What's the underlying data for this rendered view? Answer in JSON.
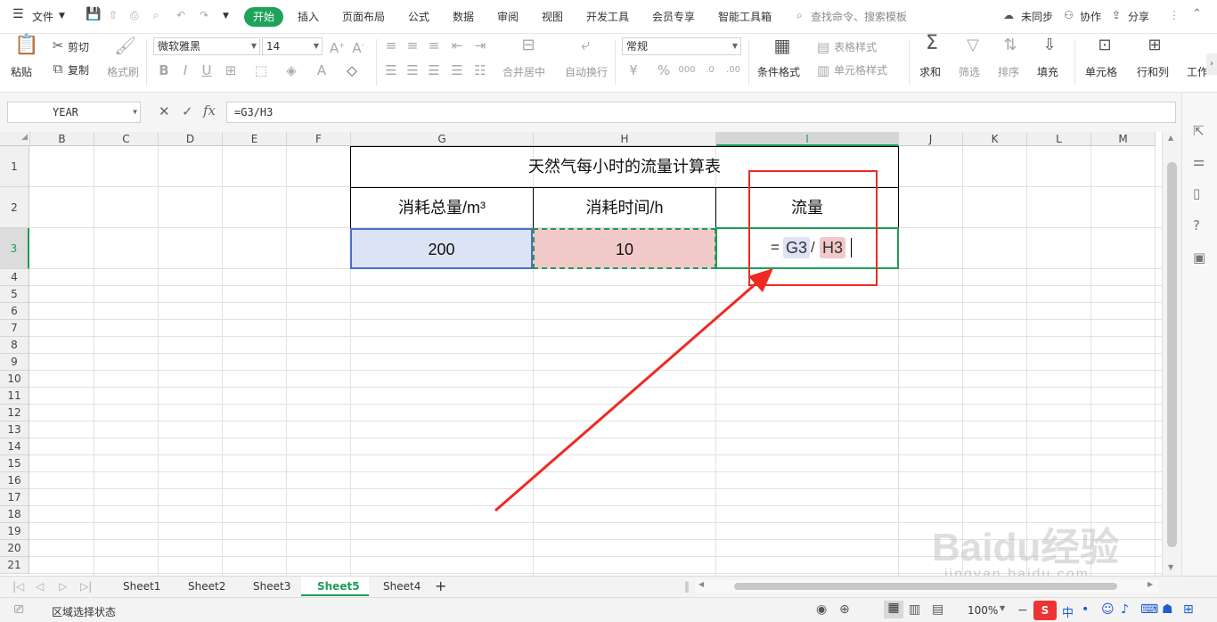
{
  "menubar": {
    "menu_icon": "hamburger-icon",
    "file": "文件",
    "tabs": [
      "开始",
      "插入",
      "页面布局",
      "公式",
      "数据",
      "审阅",
      "视图",
      "开发工具",
      "会员专享",
      "智能工具箱"
    ],
    "active_tab": "开始",
    "search_placeholder": "查找命令、搜索模板",
    "sync": "未同步",
    "collab": "协作",
    "share": "分享"
  },
  "ribbon": {
    "paste": "粘贴",
    "cut": "剪切",
    "copy": "复制",
    "format_painter": "格式刷",
    "font_name": "微软雅黑",
    "font_size": "14",
    "merge_center": "合并居中",
    "wrap_text": "自动换行",
    "number_format": "常规",
    "cond_format": "条件格式",
    "table_style": "表格样式",
    "cell_style": "单元格样式",
    "sum": "求和",
    "filter": "筛选",
    "sort": "排序",
    "fill": "填充",
    "cell": "单元格",
    "row_col": "行和列",
    "worksheet": "工作",
    "accent_color": "#1fa35b"
  },
  "formula_bar": {
    "name_box": "YEAR",
    "fx": "fx",
    "content": "=G3/H3"
  },
  "grid": {
    "columns": [
      "B",
      "C",
      "D",
      "E",
      "F",
      "G",
      "H",
      "I",
      "J",
      "K",
      "L",
      "M"
    ],
    "selected_column": "I",
    "rows": [
      "1",
      "2",
      "3",
      "4",
      "5",
      "6",
      "7",
      "8",
      "9",
      "10",
      "11",
      "12",
      "13",
      "14",
      "15",
      "16",
      "17",
      "18",
      "19",
      "20",
      "21"
    ],
    "selected_row": "3",
    "table_title": "天然气每小时的流量计算表",
    "headers": [
      "消耗总量/m³",
      "消耗时间/h",
      "流量"
    ],
    "values": [
      "200",
      "10"
    ],
    "formula_display": {
      "eq": "=",
      "ref1": "G3",
      "div": "/",
      "ref2": "H3"
    },
    "ref1_color": "#dce3f5",
    "ref2_color": "#f1c9c9"
  },
  "sheets": {
    "tabs": [
      "Sheet1",
      "Sheet2",
      "Sheet3",
      "Sheet5",
      "Sheet4"
    ],
    "active": "Sheet5",
    "add": "+"
  },
  "status": {
    "mode": "区域选择状态",
    "zoom": "100%",
    "ime": "中",
    "watermark_brand": "Baidu经验",
    "watermark_url": "jingyan.baidu.com"
  },
  "annotation": {
    "highlight_color": "#ee2a24"
  }
}
